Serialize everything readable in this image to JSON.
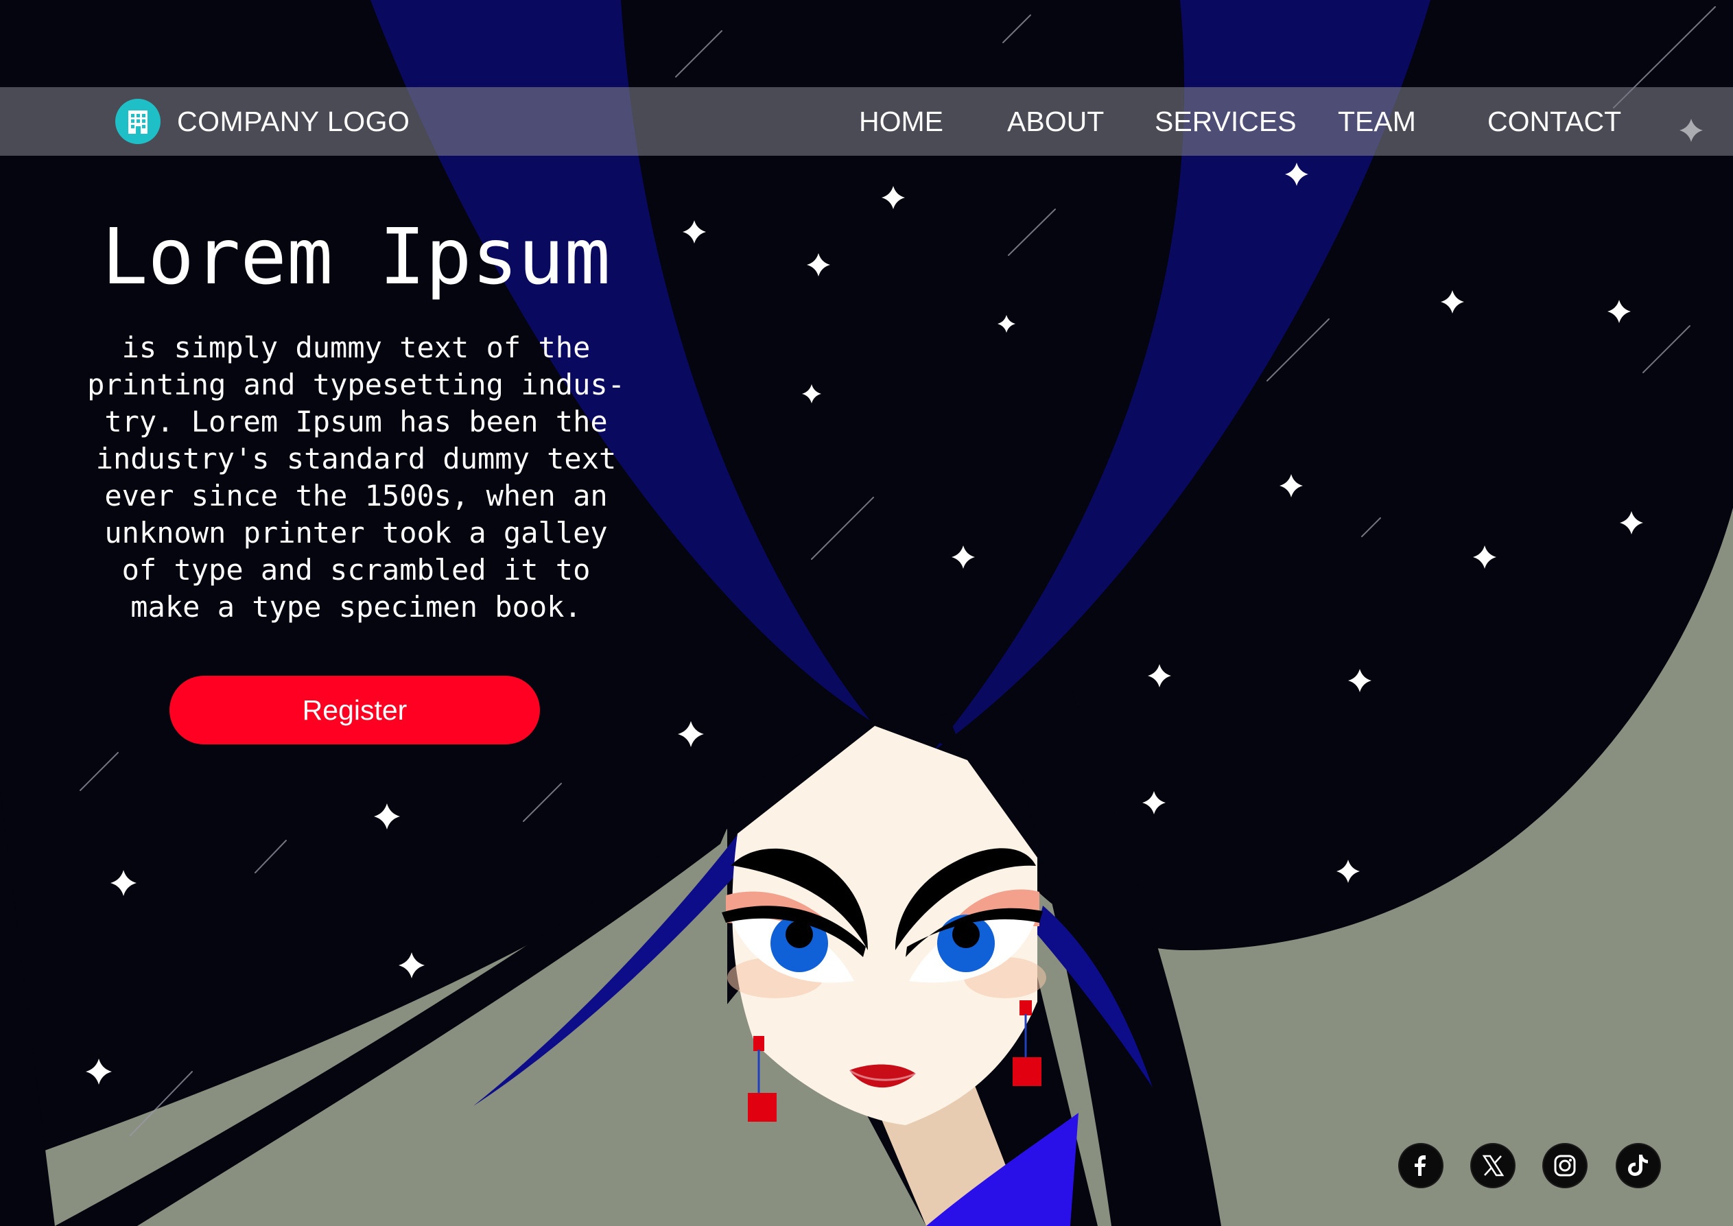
{
  "nav": {
    "logo_text": "COMPANY LOGO",
    "logo_icon": "building-icon",
    "items": [
      {
        "label": "HOME"
      },
      {
        "label": "ABOUT"
      },
      {
        "label": "SERVICES"
      },
      {
        "label": "TEAM"
      },
      {
        "label": "CONTACT"
      }
    ]
  },
  "hero": {
    "title": "Lorem Ipsum",
    "lines": [
      "is simply dummy text of the",
      "printing and typesetting indus-",
      "try. Lorem Ipsum has been the",
      "industry's standard dummy text",
      "ever since the 1500s, when an",
      "unknown printer took a galley",
      "of type and scrambled it to",
      "make a type specimen book."
    ],
    "register_label": "Register"
  },
  "social": [
    {
      "icon": "facebook-icon"
    },
    {
      "icon": "x-icon"
    },
    {
      "icon": "instagram-icon"
    },
    {
      "icon": "tiktok-icon"
    }
  ],
  "colors": {
    "background": "#04050f",
    "accent": "#ff0022",
    "logo_accent": "#1fbfc7",
    "cloak": "#8a9080",
    "beam": "#0a0a6e"
  }
}
